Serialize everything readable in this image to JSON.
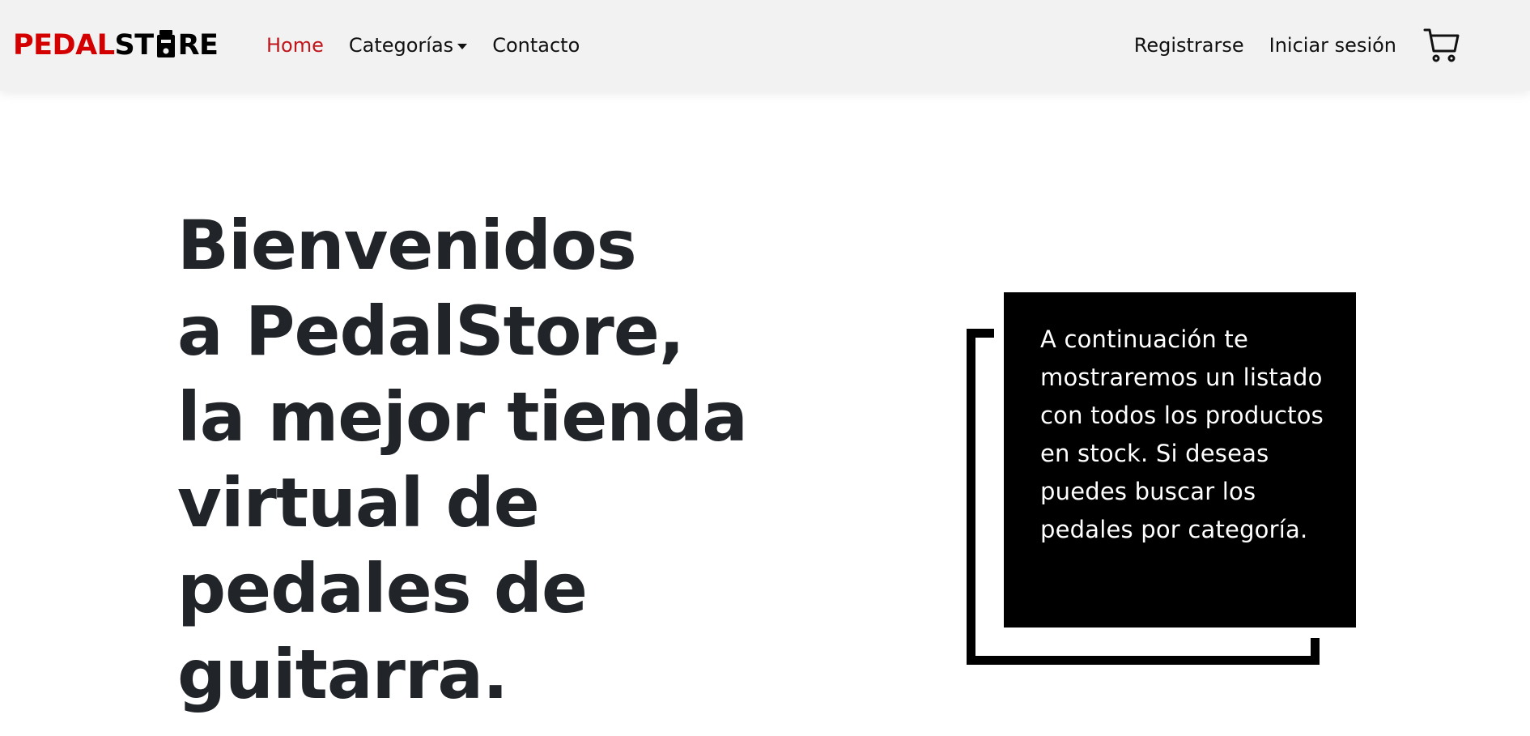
{
  "navbar": {
    "brand": {
      "part1": "PEDAL",
      "part2": "ST",
      "part3": "RE"
    },
    "links": [
      {
        "label": "Home",
        "active": true
      },
      {
        "label": "Categorías",
        "dropdown": true
      },
      {
        "label": "Contacto"
      }
    ],
    "right_links": [
      {
        "label": "Registrarse"
      },
      {
        "label": "Iniciar sesión"
      }
    ],
    "cart_icon": "cart-icon"
  },
  "hero": {
    "lines": [
      "Bienvenidos",
      "a PedalStore,",
      "la mejor tienda",
      "virtual de",
      "pedales de",
      "guitarra."
    ]
  },
  "info": {
    "text": "A continuación te mostraremos un listado con todos los productos en stock. Si deseas puedes buscar los pedales por categoría."
  },
  "colors": {
    "brand_red": "#d40000",
    "active_link": "#c0151b",
    "navbar_bg": "#f2f2f2",
    "info_box_bg": "#000000"
  }
}
